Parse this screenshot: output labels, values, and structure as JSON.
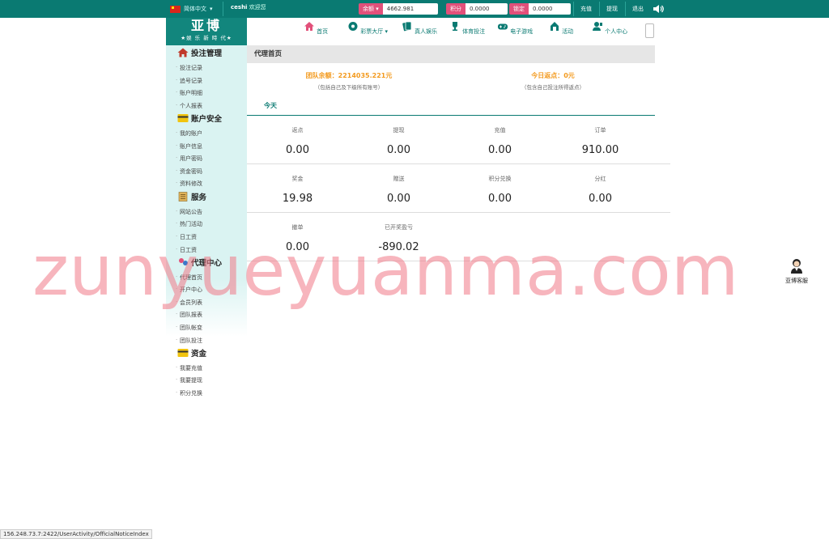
{
  "topbar": {
    "language": "简体中文",
    "username": "ceshi",
    "welcome": "欢迎您",
    "balance_label": "余额",
    "balance_value": "4662.981",
    "points_label": "积分",
    "points_value": "0.0000",
    "frozen_label": "锁定",
    "frozen_value": "0.0000",
    "recharge": "充值",
    "withdraw": "提现",
    "logout": "退出"
  },
  "logo": {
    "title": "亚博",
    "slogan": "★娱 乐 新 時 代★"
  },
  "nav": [
    {
      "label": "首页",
      "icon": "home-icon"
    },
    {
      "label": "彩票大厅",
      "icon": "lottery-icon"
    },
    {
      "label": "真人娱乐",
      "icon": "cards-icon"
    },
    {
      "label": "体育投注",
      "icon": "trophy-icon"
    },
    {
      "label": "电子游戏",
      "icon": "gamepad-icon"
    },
    {
      "label": "活动",
      "icon": "gift-icon"
    },
    {
      "label": "个人中心",
      "icon": "user-icon"
    }
  ],
  "sidebar": {
    "bet_management": {
      "title": "投注管理",
      "items": [
        "投注记录",
        "追号记录",
        "账户明细",
        "个人报表"
      ]
    },
    "account_security": {
      "title": "账户安全",
      "items": [
        "我的账户",
        "账户信息",
        "用户密码",
        "资金密码",
        "资料修改"
      ]
    },
    "service": {
      "title": "服务",
      "items": [
        "网站公告",
        "热门活动",
        "日工资",
        "日工资"
      ]
    },
    "agent_center": {
      "title": "代理中心",
      "items": [
        "代理首页",
        "开户中心",
        "会员列表",
        "团队报表",
        "团队帐变",
        "团队投注"
      ]
    },
    "funds": {
      "title": "资金",
      "items": [
        "我要充值",
        "我要提现",
        "积分兑换"
      ]
    }
  },
  "main": {
    "title": "代理首页",
    "team_balance": "团队余额：2214035.221元",
    "team_balance_note": "（包括自己及下级所有账号）",
    "today_rebate": "今日返点：0元",
    "today_rebate_note": "（包含自己投注所得返点）",
    "tab": "今天",
    "stats": [
      [
        {
          "label": "返点",
          "value": "0.00"
        },
        {
          "label": "提现",
          "value": "0.00"
        },
        {
          "label": "充值",
          "value": "0.00"
        },
        {
          "label": "订单",
          "value": "910.00"
        }
      ],
      [
        {
          "label": "奖金",
          "value": "19.98"
        },
        {
          "label": "赠送",
          "value": "0.00"
        },
        {
          "label": "积分兑换",
          "value": "0.00"
        },
        {
          "label": "分红",
          "value": "0.00"
        }
      ],
      [
        {
          "label": "撤单",
          "value": "0.00"
        },
        {
          "label": "已开奖盈亏",
          "value": "-890.02"
        }
      ]
    ]
  },
  "watermark": "zunyueyuanma.com",
  "customer_service": "亚博客服",
  "status_url": "156.248.73.7:2422/UserActivity/OfficialNoticeIndex",
  "colors": {
    "primary": "#0a7a72",
    "accent": "#e2507a",
    "highlight": "#f39a1e",
    "sidebar_bg": "#daf3f2"
  }
}
